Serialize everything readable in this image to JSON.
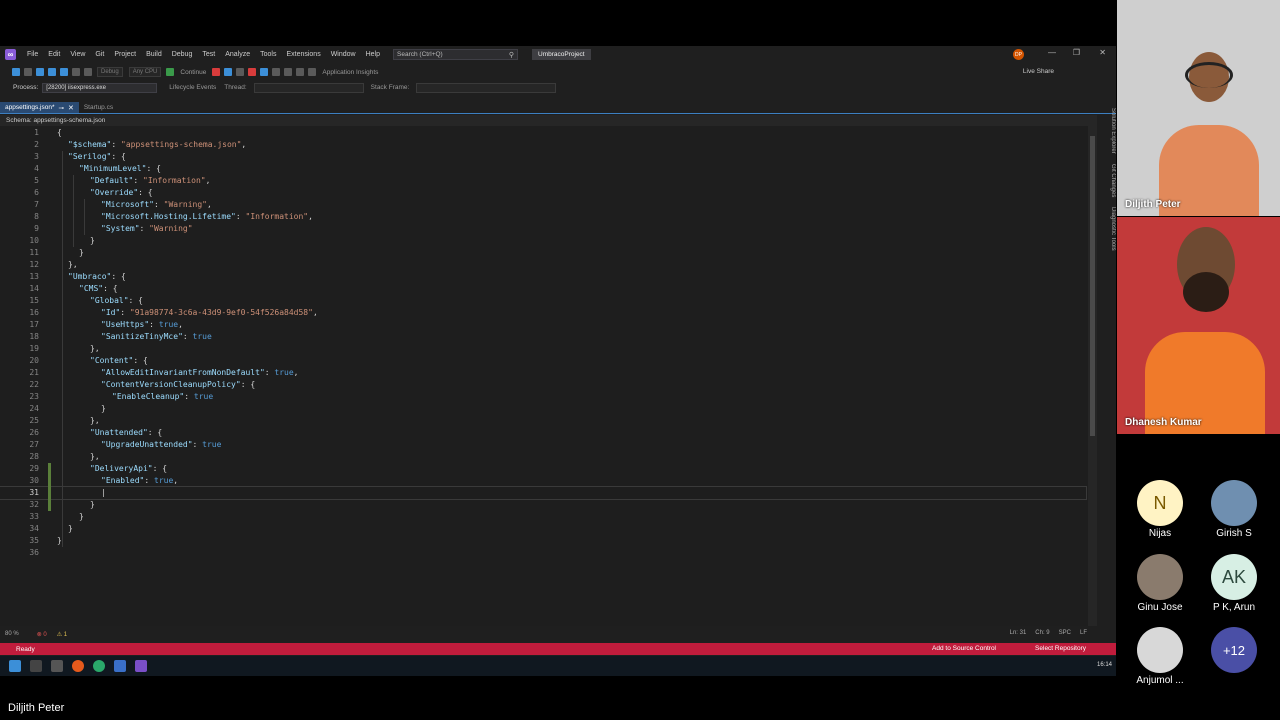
{
  "vs": {
    "menu": [
      "File",
      "Edit",
      "View",
      "Git",
      "Project",
      "Build",
      "Debug",
      "Test",
      "Analyze",
      "Tools",
      "Extensions",
      "Window",
      "Help"
    ],
    "search_placeholder": "Search (Ctrl+Q)",
    "project_name": "UmbracoProject",
    "user_initials": "DP",
    "toolbar": {
      "config": "Debug",
      "platform": "Any CPU",
      "continue_label": "Continue",
      "app_insights": "Application Insights",
      "live_share": "Live Share"
    },
    "toolbar2": {
      "process_label": "Process:",
      "process_value": "[28200] iisexpress.exe",
      "lifecycle": "Lifecycle Events",
      "thread": "Thread:",
      "stack_frame": "Stack Frame:"
    },
    "tabs": [
      {
        "label": "appsettings.json*",
        "active": true
      },
      {
        "label": "Startup.cs",
        "active": false
      }
    ],
    "schema_bar": "Schema: appsettings-schema.json",
    "side_tabs": [
      "Solution Explorer",
      "Git Changes",
      "Diagnostic Tools"
    ],
    "editor_status": {
      "zoom": "80 %",
      "errors": "0",
      "warnings": "1",
      "ln": "Ln: 31",
      "ch": "Ch: 9",
      "spc": "SPC",
      "lf": "LF"
    },
    "statusbar": {
      "ready": "Ready",
      "source_control": "Add to Source Control",
      "repository": "Select Repository"
    },
    "clock": "16:14",
    "code_lines": [
      {
        "n": "1",
        "indent": 0,
        "parts": [
          [
            "p",
            "{"
          ]
        ]
      },
      {
        "n": "2",
        "indent": 1,
        "parts": [
          [
            "k",
            "\"$schema\""
          ],
          [
            "p",
            ": "
          ],
          [
            "s",
            "\"appsettings-schema.json\""
          ],
          [
            "p",
            ","
          ]
        ]
      },
      {
        "n": "3",
        "indent": 1,
        "parts": [
          [
            "k",
            "\"Serilog\""
          ],
          [
            "p",
            ": {"
          ]
        ]
      },
      {
        "n": "4",
        "indent": 2,
        "parts": [
          [
            "k",
            "\"MinimumLevel\""
          ],
          [
            "p",
            ": {"
          ]
        ]
      },
      {
        "n": "5",
        "indent": 3,
        "parts": [
          [
            "k",
            "\"Default\""
          ],
          [
            "p",
            ": "
          ],
          [
            "s",
            "\"Information\""
          ],
          [
            "p",
            ","
          ]
        ]
      },
      {
        "n": "6",
        "indent": 3,
        "parts": [
          [
            "k",
            "\"Override\""
          ],
          [
            "p",
            ": {"
          ]
        ]
      },
      {
        "n": "7",
        "indent": 4,
        "parts": [
          [
            "k",
            "\"Microsoft\""
          ],
          [
            "p",
            ": "
          ],
          [
            "s",
            "\"Warning\""
          ],
          [
            "p",
            ","
          ]
        ]
      },
      {
        "n": "8",
        "indent": 4,
        "parts": [
          [
            "k",
            "\"Microsoft.Hosting.Lifetime\""
          ],
          [
            "p",
            ": "
          ],
          [
            "s",
            "\"Information\""
          ],
          [
            "p",
            ","
          ]
        ]
      },
      {
        "n": "9",
        "indent": 4,
        "parts": [
          [
            "k",
            "\"System\""
          ],
          [
            "p",
            ": "
          ],
          [
            "s",
            "\"Warning\""
          ]
        ]
      },
      {
        "n": "10",
        "indent": 3,
        "parts": [
          [
            "p",
            "}"
          ]
        ]
      },
      {
        "n": "11",
        "indent": 2,
        "parts": [
          [
            "p",
            "}"
          ]
        ]
      },
      {
        "n": "12",
        "indent": 1,
        "parts": [
          [
            "p",
            "},"
          ]
        ]
      },
      {
        "n": "13",
        "indent": 1,
        "parts": [
          [
            "k",
            "\"Umbraco\""
          ],
          [
            "p",
            ": {"
          ]
        ]
      },
      {
        "n": "14",
        "indent": 2,
        "parts": [
          [
            "k",
            "\"CMS\""
          ],
          [
            "p",
            ": {"
          ]
        ]
      },
      {
        "n": "15",
        "indent": 3,
        "parts": [
          [
            "k",
            "\"Global\""
          ],
          [
            "p",
            ": {"
          ]
        ]
      },
      {
        "n": "16",
        "indent": 4,
        "parts": [
          [
            "k",
            "\"Id\""
          ],
          [
            "p",
            ": "
          ],
          [
            "s",
            "\"91a98774-3c6a-43d9-9ef0-54f526a84d58\""
          ],
          [
            "p",
            ","
          ]
        ]
      },
      {
        "n": "17",
        "indent": 4,
        "parts": [
          [
            "k",
            "\"UseHttps\""
          ],
          [
            "p",
            ": "
          ],
          [
            "b",
            "true"
          ],
          [
            "p",
            ","
          ]
        ]
      },
      {
        "n": "18",
        "indent": 4,
        "parts": [
          [
            "k",
            "\"SanitizeTinyMce\""
          ],
          [
            "p",
            ": "
          ],
          [
            "b",
            "true"
          ]
        ]
      },
      {
        "n": "19",
        "indent": 3,
        "parts": [
          [
            "p",
            "},"
          ]
        ]
      },
      {
        "n": "20",
        "indent": 3,
        "parts": [
          [
            "k",
            "\"Content\""
          ],
          [
            "p",
            ": {"
          ]
        ]
      },
      {
        "n": "21",
        "indent": 4,
        "parts": [
          [
            "k",
            "\"AllowEditInvariantFromNonDefault\""
          ],
          [
            "p",
            ": "
          ],
          [
            "b",
            "true"
          ],
          [
            "p",
            ","
          ]
        ]
      },
      {
        "n": "22",
        "indent": 4,
        "parts": [
          [
            "k",
            "\"ContentVersionCleanupPolicy\""
          ],
          [
            "p",
            ": {"
          ]
        ]
      },
      {
        "n": "23",
        "indent": 5,
        "parts": [
          [
            "k",
            "\"EnableCleanup\""
          ],
          [
            "p",
            ": "
          ],
          [
            "b",
            "true"
          ]
        ]
      },
      {
        "n": "24",
        "indent": 4,
        "parts": [
          [
            "p",
            "}"
          ]
        ]
      },
      {
        "n": "25",
        "indent": 3,
        "parts": [
          [
            "p",
            "},"
          ]
        ]
      },
      {
        "n": "26",
        "indent": 3,
        "parts": [
          [
            "k",
            "\"Unattended\""
          ],
          [
            "p",
            ": {"
          ]
        ]
      },
      {
        "n": "27",
        "indent": 4,
        "parts": [
          [
            "k",
            "\"UpgradeUnattended\""
          ],
          [
            "p",
            ": "
          ],
          [
            "b",
            "true"
          ]
        ]
      },
      {
        "n": "28",
        "indent": 3,
        "parts": [
          [
            "p",
            "},"
          ]
        ]
      },
      {
        "n": "29",
        "indent": 3,
        "parts": [
          [
            "k",
            "\"DeliveryApi\""
          ],
          [
            "p",
            ": {"
          ]
        ]
      },
      {
        "n": "30",
        "indent": 4,
        "parts": [
          [
            "k",
            "\"Enabled\""
          ],
          [
            "p",
            ": "
          ],
          [
            "b",
            "true"
          ],
          [
            "p",
            ","
          ]
        ]
      },
      {
        "n": "31",
        "indent": 4,
        "parts": [
          [
            "p",
            "|"
          ]
        ],
        "current": true
      },
      {
        "n": "32",
        "indent": 3,
        "parts": [
          [
            "p",
            "}"
          ]
        ]
      },
      {
        "n": "33",
        "indent": 2,
        "parts": [
          [
            "p",
            "}"
          ]
        ]
      },
      {
        "n": "34",
        "indent": 1,
        "parts": [
          [
            "p",
            "}"
          ]
        ]
      },
      {
        "n": "35",
        "indent": 0,
        "parts": [
          [
            "p",
            "}"
          ]
        ]
      },
      {
        "n": "36",
        "indent": 0,
        "parts": []
      }
    ]
  },
  "meeting": {
    "video_tiles": [
      {
        "name": "Diljith Peter",
        "shirt": "#e2895a",
        "bg": "#cfcfcf"
      },
      {
        "name": "Dhanesh Kumar",
        "shirt": "#f07a2a",
        "bg": "#c23a3a"
      }
    ],
    "participants": [
      {
        "name": "Nijas",
        "initials": "N",
        "color": "#fff3c4"
      },
      {
        "name": "Girish S",
        "initials": "",
        "color": "#6f8fb0"
      },
      {
        "name": "Ginu Jose",
        "initials": "",
        "color": "#8a7b6d"
      },
      {
        "name": "P K, Arun",
        "initials": "AK",
        "color": "#d7efe4"
      },
      {
        "name": "Anjumol ...",
        "initials": "",
        "color": "#d8d8d8"
      }
    ],
    "more_count": "+12",
    "presenter": "Diljith Peter"
  }
}
